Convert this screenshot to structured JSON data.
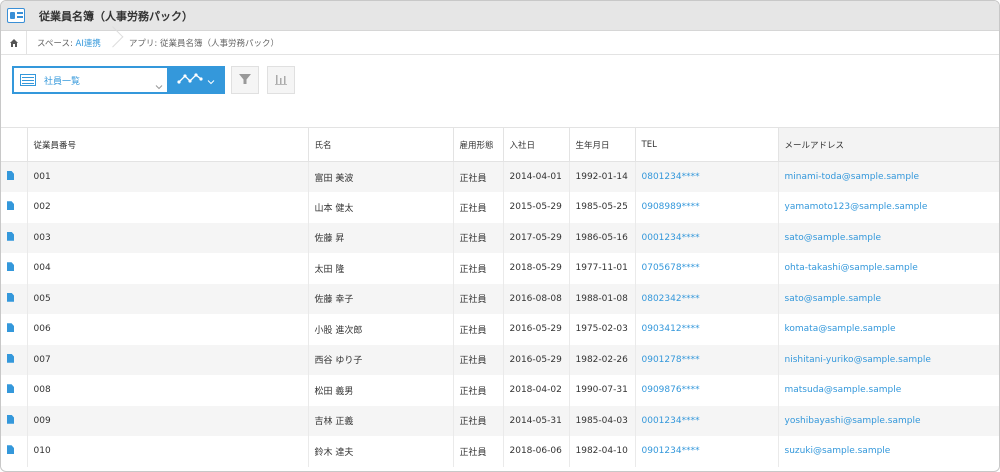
{
  "header": {
    "title": "従業員名簿（人事労務パック）"
  },
  "breadcrumb": {
    "space_prefix": "スペース: ",
    "space_name": "AI連携",
    "app_label": "アプリ: 従業員名簿（人事労務パック）"
  },
  "toolbar": {
    "view_name": "社員一覧"
  },
  "colors": {
    "accent": "#3498db"
  },
  "table": {
    "columns": [
      "従業員番号",
      "氏名",
      "雇用形態",
      "入社日",
      "生年月日",
      "TEL",
      "メールアドレス"
    ],
    "rows": [
      {
        "id": "001",
        "name": "富田 美波",
        "type": "正社員",
        "joined": "2014-04-01",
        "birth": "1992-01-14",
        "tel": "0801234****",
        "email": "minami-toda@sample.sample"
      },
      {
        "id": "002",
        "name": "山本 健太",
        "type": "正社員",
        "joined": "2015-05-29",
        "birth": "1985-05-25",
        "tel": "0908989****",
        "email": "yamamoto123@sample.sample"
      },
      {
        "id": "003",
        "name": "佐藤 昇",
        "type": "正社員",
        "joined": "2017-05-29",
        "birth": "1986-05-16",
        "tel": "0001234****",
        "email": "sato@sample.sample"
      },
      {
        "id": "004",
        "name": "太田 隆",
        "type": "正社員",
        "joined": "2018-05-29",
        "birth": "1977-11-01",
        "tel": "0705678****",
        "email": "ohta-takashi@sample.sample"
      },
      {
        "id": "005",
        "name": "佐藤 幸子",
        "type": "正社員",
        "joined": "2016-08-08",
        "birth": "1988-01-08",
        "tel": "0802342****",
        "email": "sato@sample.sample"
      },
      {
        "id": "006",
        "name": "小股 進次郎",
        "type": "正社員",
        "joined": "2016-05-29",
        "birth": "1975-02-03",
        "tel": "0903412****",
        "email": "komata@sample.sample"
      },
      {
        "id": "007",
        "name": "西谷 ゆり子",
        "type": "正社員",
        "joined": "2016-05-29",
        "birth": "1982-02-26",
        "tel": "0901278****",
        "email": "nishitani-yuriko@sample.sample"
      },
      {
        "id": "008",
        "name": "松田 義男",
        "type": "正社員",
        "joined": "2018-04-02",
        "birth": "1990-07-31",
        "tel": "0909876****",
        "email": "matsuda@sample.sample"
      },
      {
        "id": "009",
        "name": "吉林 正義",
        "type": "正社員",
        "joined": "2014-05-31",
        "birth": "1985-04-03",
        "tel": "0001234****",
        "email": "yoshibayashi@sample.sample"
      },
      {
        "id": "010",
        "name": "鈴木 達夫",
        "type": "正社員",
        "joined": "2018-06-06",
        "birth": "1982-04-10",
        "tel": "0901234****",
        "email": "suzuki@sample.sample"
      }
    ]
  }
}
